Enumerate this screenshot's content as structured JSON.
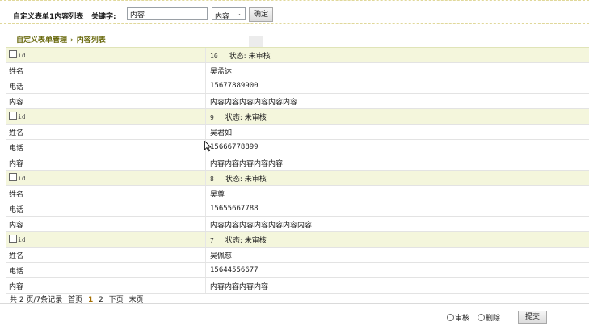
{
  "search": {
    "form_title": "自定义表单1内容列表",
    "keyword_label": "关键字:",
    "keyword_value": "内容",
    "field_selected": "内容",
    "confirm_label": "确定"
  },
  "breadcrumb": {
    "root": "自定义表单管理",
    "separator": "›",
    "current": "内容列表"
  },
  "labels": {
    "id": "id",
    "status_prefix": "状态:",
    "name": "姓名",
    "phone": "电话",
    "content": "内容"
  },
  "records": [
    {
      "id": "10",
      "status": "未审核",
      "name": "吴孟达",
      "phone": "15677889900",
      "content": "内容内容内容内容内容内容"
    },
    {
      "id": "9",
      "status": "未审核",
      "name": "吴君如",
      "phone": "15666778899",
      "content": "内容内容内容内容内容"
    },
    {
      "id": "8",
      "status": "未审核",
      "name": "吴尊",
      "phone": "15655667788",
      "content": "内容内容内容内容内容内容内容"
    },
    {
      "id": "7",
      "status": "未审核",
      "name": "吴佩慈",
      "phone": "15644556677",
      "content": "内容内容内容内容"
    }
  ],
  "pager": {
    "summary": "共 2 页/7条记录",
    "first": "首页",
    "current_page": "1",
    "page2": "2",
    "next": "下页",
    "last": "末页"
  },
  "actions": {
    "approve_label": "审核",
    "delete_label": "删除",
    "submit_label": "提交"
  },
  "colors": {
    "header_row_bg": "#f4f6dc",
    "breadcrumb_text": "#6b6b10",
    "current_page": "#a36d00"
  }
}
